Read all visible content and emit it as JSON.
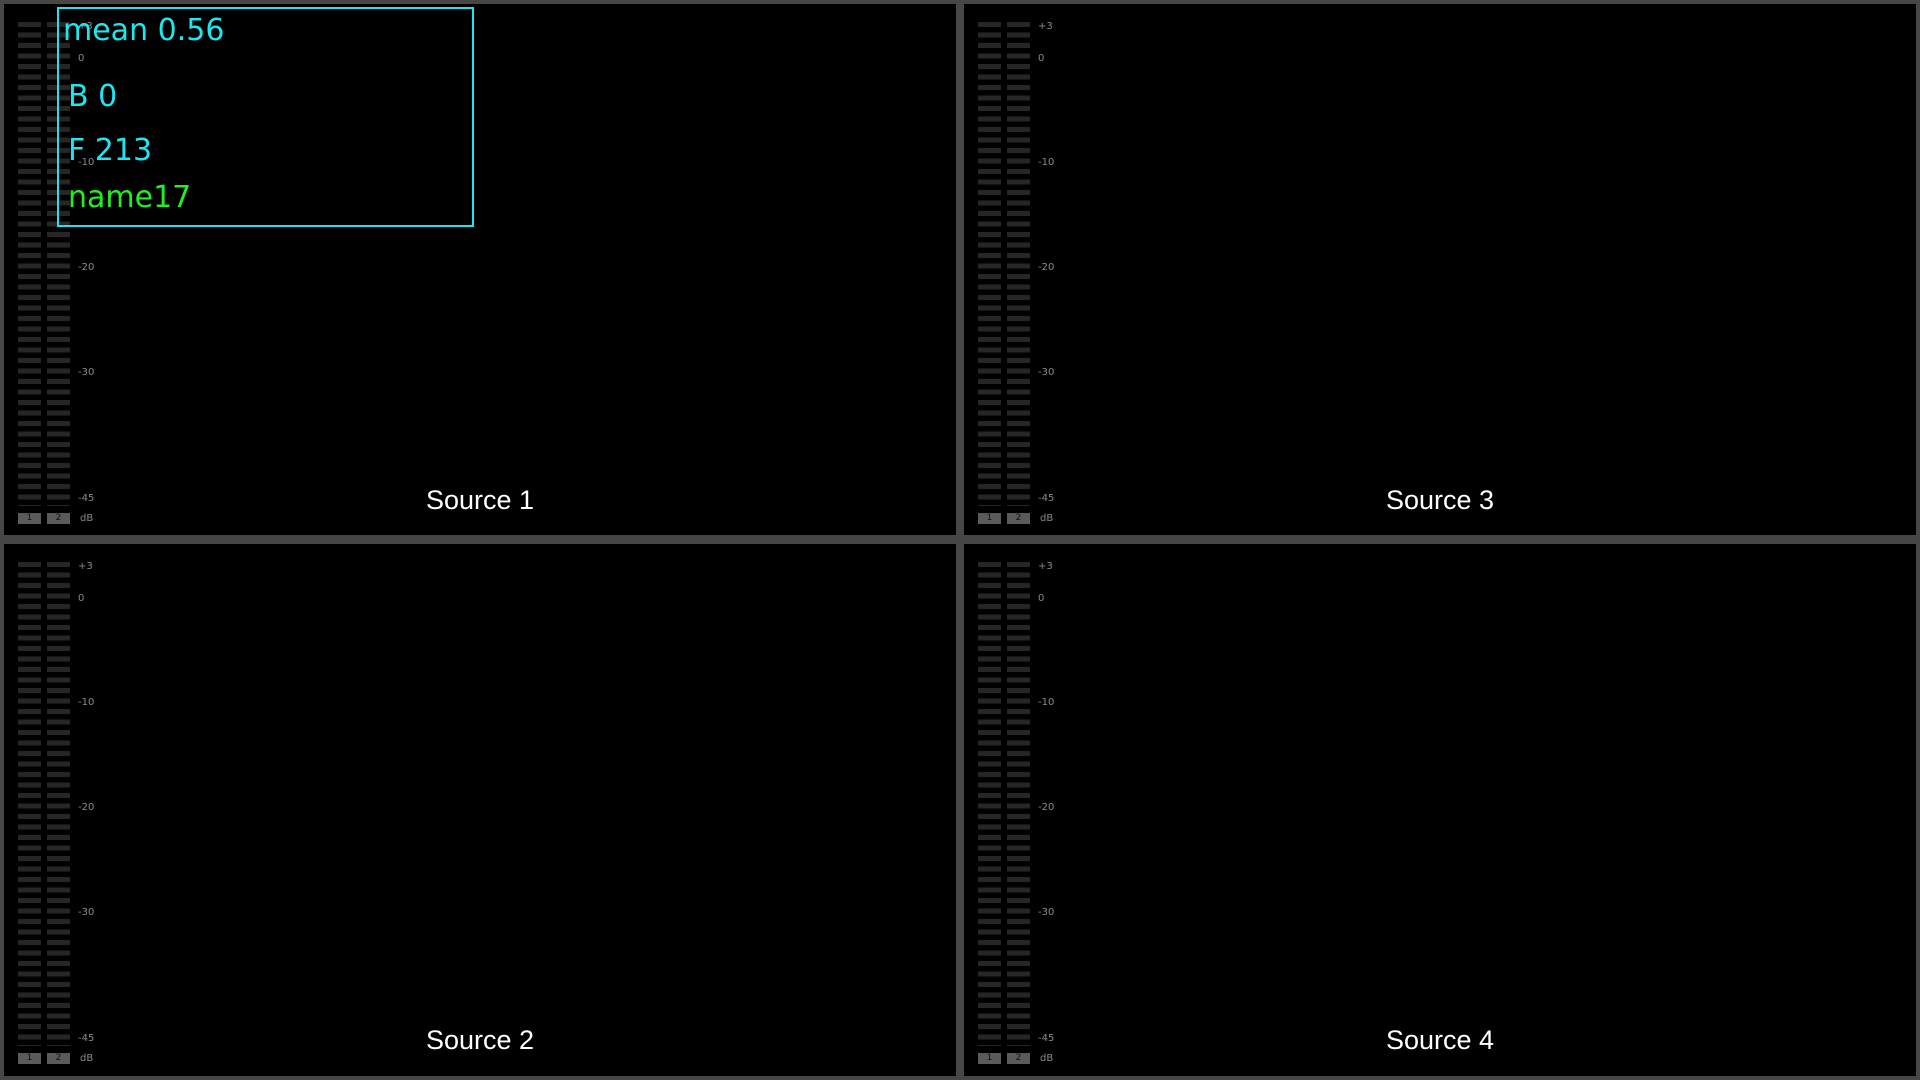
{
  "meter_scale": [
    "+3",
    "0",
    "-10",
    "-20",
    "-30",
    "-45"
  ],
  "meter_channels": [
    "1",
    "2"
  ],
  "meter_unit": "dB",
  "overlay": {
    "mean": "mean 0.56",
    "b": "B 0",
    "f": "F 213",
    "name": "name17",
    "box_color": "#1ee6f0",
    "name_color": "#22ee22"
  },
  "tiles": [
    {
      "source": "Source 1"
    },
    {
      "source": "Source 3"
    },
    {
      "source": "Source 2"
    },
    {
      "source": "Source 4"
    }
  ],
  "colors": {
    "frame": "#464646",
    "tile_bg": "#000000",
    "meter_segment": "#262626",
    "label_text": "#ffffff"
  }
}
